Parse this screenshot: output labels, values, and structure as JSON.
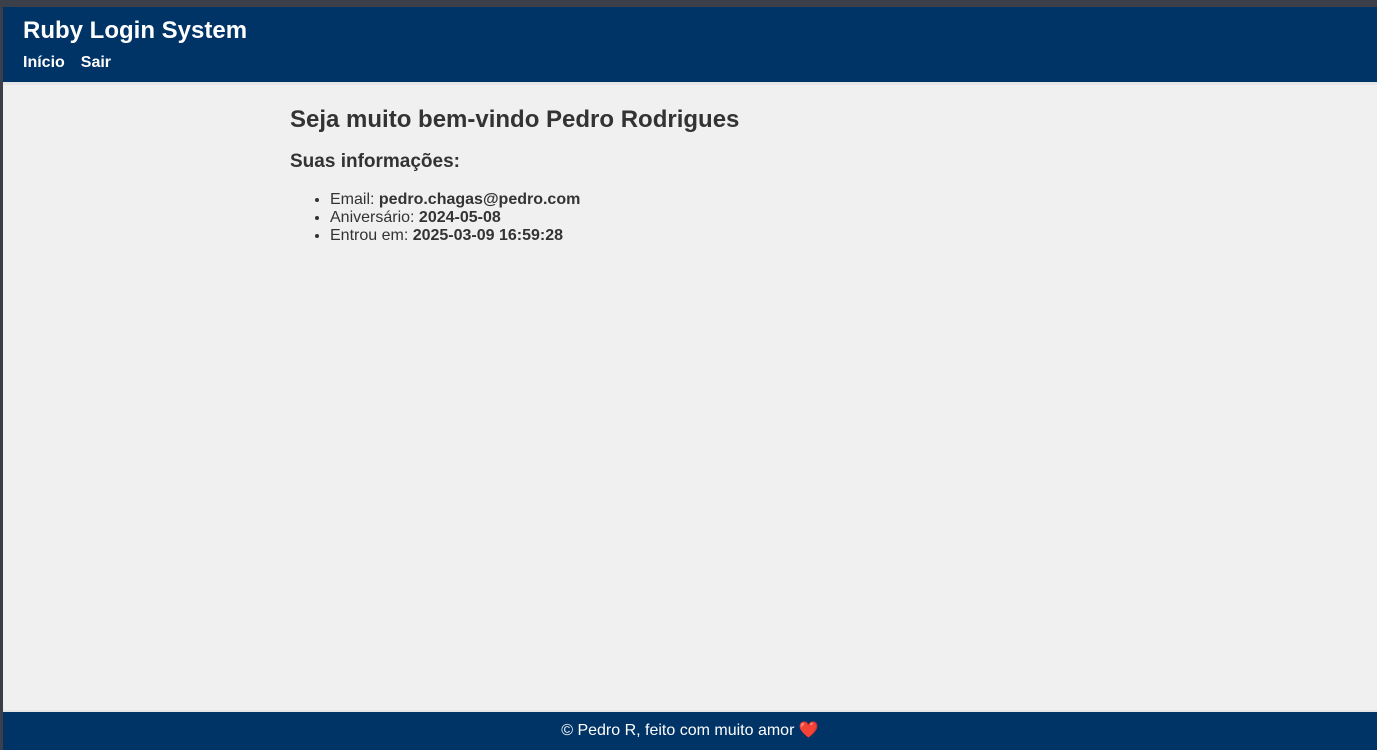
{
  "header": {
    "title": "Ruby Login System",
    "nav": [
      {
        "label": "Início"
      },
      {
        "label": "Sair"
      }
    ]
  },
  "main": {
    "welcome": "Seja muito bem-vindo Pedro Rodrigues",
    "info_title": "Suas informações:",
    "info": {
      "email_label": "Email:",
      "email_value": "pedro.chagas@pedro.com",
      "birthday_label": "Aniversário:",
      "birthday_value": "2024-05-08",
      "joined_label": "Entrou em:",
      "joined_value": "2025-03-09 16:59:28"
    }
  },
  "footer": {
    "text": "© Pedro R, feito com muito amor",
    "heart": "❤️"
  },
  "colors": {
    "header_bg": "#003366",
    "page_bg": "#f0f0f0",
    "text": "#333333"
  }
}
